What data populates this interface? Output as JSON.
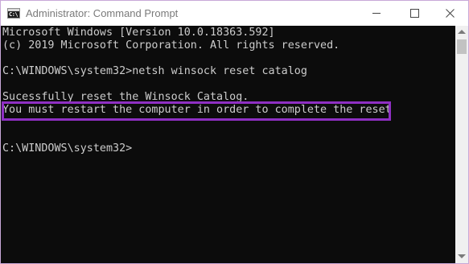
{
  "window": {
    "title": "Administrator: Command Prompt",
    "app_icon_glyph": "C:\\",
    "icons": {
      "app": "command-prompt-icon",
      "minimize": "minimize-icon",
      "maximize": "maximize-icon",
      "close": "close-icon"
    }
  },
  "console": {
    "lines": [
      "Microsoft Windows [Version 10.0.18363.592]",
      "(c) 2019 Microsoft Corporation. All rights reserved.",
      "",
      "C:\\WINDOWS\\system32>netsh winsock reset catalog",
      "",
      "Sucessfully reset the Winsock Catalog.",
      "You must restart the computer in order to complete the reset",
      "",
      "",
      "C:\\WINDOWS\\system32>"
    ]
  },
  "colors": {
    "console_bg": "#0c0c0c",
    "console_text": "#cccccc",
    "highlight": "#8e2fc3",
    "titlebar_bg": "#ffffff",
    "title_text": "#7a7a7a"
  }
}
